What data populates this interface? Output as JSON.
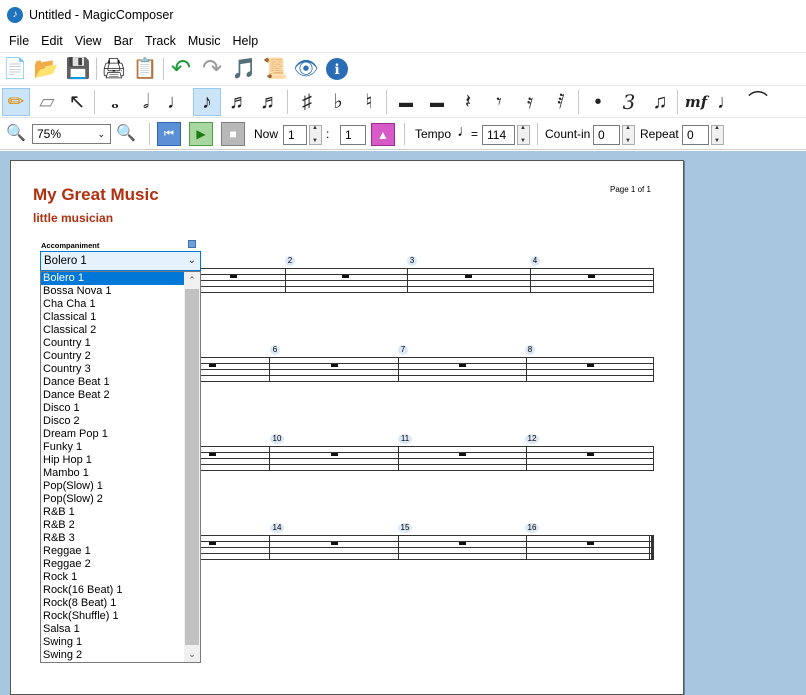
{
  "window": {
    "title": "Untitled - MagicComposer"
  },
  "menu": [
    "File",
    "Edit",
    "View",
    "Bar",
    "Track",
    "Music",
    "Help"
  ],
  "toolbar1": [
    {
      "name": "new-document-icon",
      "glyph": "📄"
    },
    {
      "name": "open-folder-icon",
      "glyph": "📂"
    },
    {
      "name": "save-icon",
      "glyph": "💾"
    },
    {
      "name": "print-icon",
      "glyph": "🖨"
    },
    {
      "name": "print-preview-icon",
      "glyph": "📋"
    },
    {
      "name": "undo-icon",
      "glyph": "↶"
    },
    {
      "name": "redo-icon",
      "glyph": "↷"
    },
    {
      "name": "track-icon",
      "glyph": "🎵"
    },
    {
      "name": "score-settings-icon",
      "glyph": "📜"
    },
    {
      "name": "view-icon",
      "glyph": "👁"
    },
    {
      "name": "info-icon",
      "glyph": "ℹ"
    }
  ],
  "toolbar2": [
    {
      "name": "pencil-icon",
      "glyph": "✏"
    },
    {
      "name": "eraser-icon",
      "glyph": "▱"
    },
    {
      "name": "select-arrow-icon",
      "glyph": "↖"
    },
    {
      "name": "whole-note-icon",
      "glyph": "𝅝"
    },
    {
      "name": "half-note-icon",
      "glyph": "𝅗𝅥"
    },
    {
      "name": "quarter-note-icon",
      "glyph": "♩"
    },
    {
      "name": "eighth-note-icon",
      "glyph": "♪"
    },
    {
      "name": "sixteenth-note-icon",
      "glyph": "♬"
    },
    {
      "name": "thirty-second-note-icon",
      "glyph": "♬"
    },
    {
      "name": "sharp-icon",
      "glyph": "♯"
    },
    {
      "name": "flat-icon",
      "glyph": "♭"
    },
    {
      "name": "natural-icon",
      "glyph": "♮"
    },
    {
      "name": "whole-rest-icon",
      "glyph": "▬"
    },
    {
      "name": "half-rest-icon",
      "glyph": "▬"
    },
    {
      "name": "quarter-rest-icon",
      "glyph": "𝄽"
    },
    {
      "name": "eighth-rest-icon",
      "glyph": "𝄾"
    },
    {
      "name": "sixteenth-rest-icon",
      "glyph": "𝄿"
    },
    {
      "name": "thirty-second-rest-icon",
      "glyph": "𝅀"
    },
    {
      "name": "dot-icon",
      "glyph": "•"
    },
    {
      "name": "triplet-icon",
      "glyph": "3"
    },
    {
      "name": "tie-icon",
      "glyph": "♫"
    },
    {
      "name": "dynamics-mf-icon",
      "glyph": "mf"
    },
    {
      "name": "accent-note-icon",
      "glyph": "♩"
    },
    {
      "name": "slur-icon",
      "glyph": "⌒"
    }
  ],
  "toolbar3": {
    "zoom_value": "75%",
    "now_label": "Now",
    "now_bar": "1",
    "now_colon": ":",
    "now_beat": "1",
    "tempo_label": "Tempo",
    "tempo_equals": "=",
    "tempo_value": "114",
    "countin_label": "Count-in",
    "countin_value": "0",
    "repeat_label": "Repeat",
    "repeat_value": "0"
  },
  "score": {
    "title": "My Great Music",
    "author": "little musician",
    "page_number": "Page 1 of 1",
    "accompaniment_label": "Accompaniment",
    "bar_numbers": {
      "row1": [
        "2",
        "3",
        "4"
      ],
      "row2": [
        "6",
        "7",
        "8"
      ],
      "row3": [
        "10",
        "11",
        "12"
      ],
      "row4": [
        "14",
        "15",
        "16"
      ]
    }
  },
  "accompaniment": {
    "selected": "Bolero 1",
    "options": [
      "Bolero 1",
      "Bossa Nova 1",
      "Cha Cha 1",
      "Classical 1",
      "Classical 2",
      "Country 1",
      "Country 2",
      "Country 3",
      "Dance Beat 1",
      "Dance Beat 2",
      "Disco 1",
      "Disco 2",
      "Dream Pop 1",
      "Funky 1",
      "Hip Hop 1",
      "Mambo 1",
      "Pop(Slow) 1",
      "Pop(Slow) 2",
      "R&B 1",
      "R&B 2",
      "R&B 3",
      "Reggae 1",
      "Reggae 2",
      "Rock 1",
      "Rock(16 Beat) 1",
      "Rock(8 Beat) 1",
      "Rock(Shuffle) 1",
      "Salsa 1",
      "Swing 1",
      "Swing 2"
    ]
  }
}
